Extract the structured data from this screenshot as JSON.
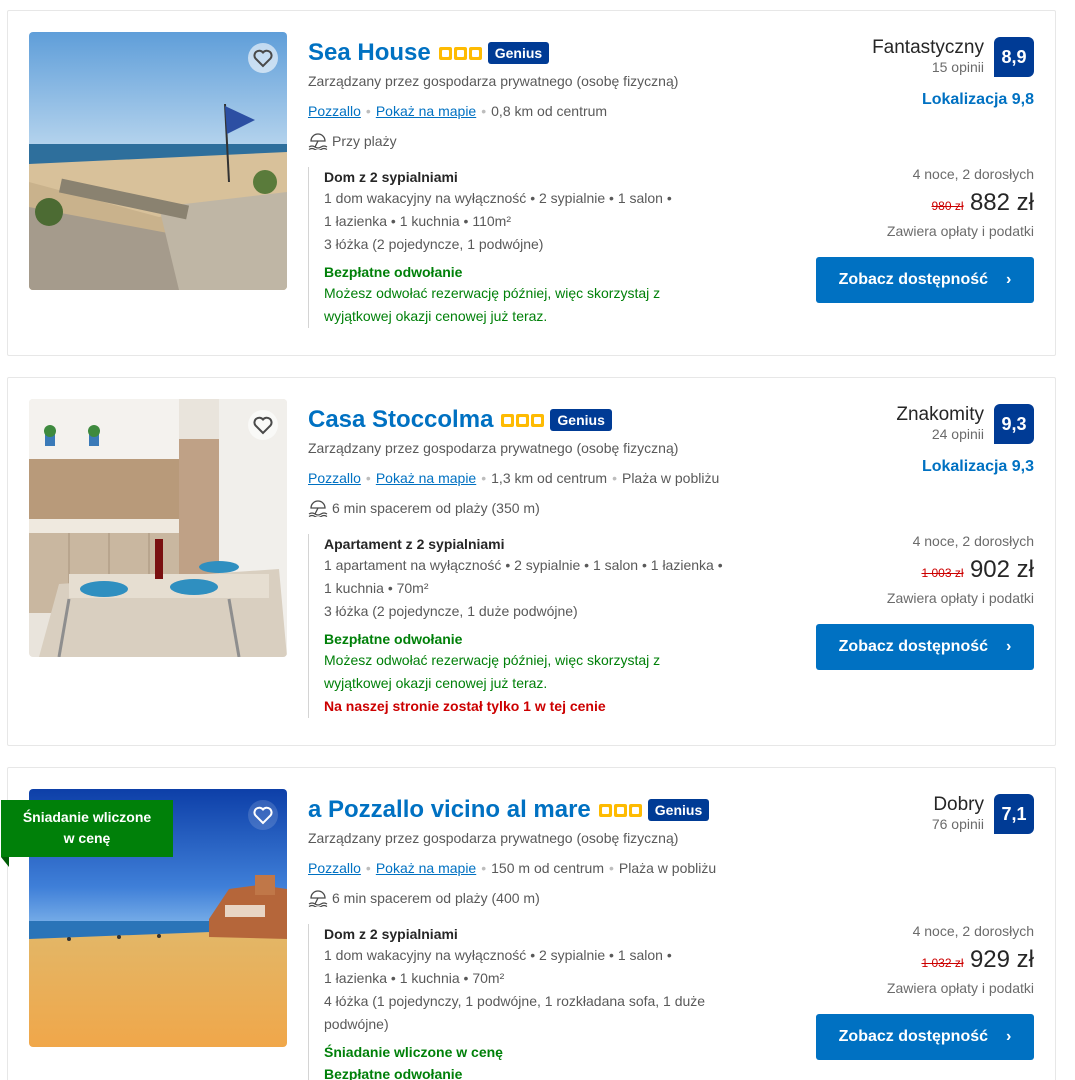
{
  "listings": [
    {
      "name": "Sea House",
      "genius": "Genius",
      "managed": "Zarządzany przez gospodarza prywatnego (osobę fizyczną)",
      "city": "Pozzallo",
      "map_link": "Pokaż na mapie",
      "distance": "0,8 km od centrum",
      "nearby": "",
      "beach": "Przy plaży",
      "room": "Dom z 2 sypialniami",
      "details": [
        "1 dom wakacyjny na wyłączność • 2 sypialnie • 1 salon •",
        "1 łazienka • 1 kuchnia • 110m²",
        "3 łóżka (2 pojedyncze, 1 podwójne)"
      ],
      "cancel": "Bezpłatne odwołanie",
      "cancel_desc": [
        "Możesz odwołać rezerwację później, więc skorzystaj z",
        "wyjątkowej okazji cenowej już teraz."
      ],
      "rating_label": "Fantastyczny",
      "reviews": "15 opinii",
      "score": "8,9",
      "location_score": "Lokalizacja 9,8",
      "stay": "4 noce, 2 dorosłych",
      "old_price": "980 zł",
      "price": "882 zł",
      "taxes": "Zawiera opłaty i podatki",
      "cta": "Zobacz dostępność"
    },
    {
      "name": "Casa Stoccolma",
      "genius": "Genius",
      "managed": "Zarządzany przez gospodarza prywatnego (osobę fizyczną)",
      "city": "Pozzallo",
      "map_link": "Pokaż na mapie",
      "distance": "1,3 km od centrum",
      "nearby": "Plaża w pobliżu",
      "beach": "6 min spacerem od plaży (350 m)",
      "room": "Apartament z 2 sypialniami",
      "details": [
        "1 apartament na wyłączność • 2 sypialnie • 1 salon • 1 łazienka •",
        "1 kuchnia • 70m²",
        "3 łóżka (2 pojedyncze, 1 duże podwójne)"
      ],
      "cancel": "Bezpłatne odwołanie",
      "cancel_desc": [
        "Możesz odwołać rezerwację później, więc skorzystaj z",
        "wyjątkowej okazji cenowej już teraz."
      ],
      "urgent": "Na naszej stronie został tylko 1 w tej cenie",
      "rating_label": "Znakomity",
      "reviews": "24 opinii",
      "score": "9,3",
      "location_score": "Lokalizacja 9,3",
      "stay": "4 noce, 2 dorosłych",
      "old_price": "1 003 zł",
      "price": "902 zł",
      "taxes": "Zawiera opłaty i podatki",
      "cta": "Zobacz dostępność"
    },
    {
      "name": "a Pozzallo vicino al mare",
      "genius": "Genius",
      "ribbon": [
        "Śniadanie wliczone",
        "w cenę"
      ],
      "managed": "Zarządzany przez gospodarza prywatnego (osobę fizyczną)",
      "city": "Pozzallo",
      "map_link": "Pokaż na mapie",
      "distance": "150 m od centrum",
      "nearby": "Plaża w pobliżu",
      "beach": "6 min spacerem od plaży (400 m)",
      "room": "Dom z 2 sypialniami",
      "details": [
        "1 dom wakacyjny na wyłączność • 2 sypialnie • 1 salon •",
        "1 łazienka • 1 kuchnia • 70m²",
        "4 łóżka (1 pojedynczy, 1 podwójne, 1 rozkładana sofa, 1 duże",
        "podwójne)"
      ],
      "breakfast": "Śniadanie wliczone w cenę",
      "cancel": "Bezpłatne odwołanie",
      "rating_label": "Dobry",
      "reviews": "76 opinii",
      "score": "7,1",
      "stay": "4 noce, 2 dorosłych",
      "old_price": "1 032 zł",
      "price": "929 zł",
      "taxes": "Zawiera opłaty i podatki",
      "cta": "Zobacz dostępność"
    }
  ],
  "colors": {
    "link": "#0071c2",
    "score_bg": "#003b95",
    "green": "#008009",
    "star": "#febb02",
    "red": "#cc0000"
  },
  "icons": {
    "favorite": "heart-outline-icon",
    "beach": "beach-umbrella-icon",
    "chevron": "chevron-right-icon"
  }
}
